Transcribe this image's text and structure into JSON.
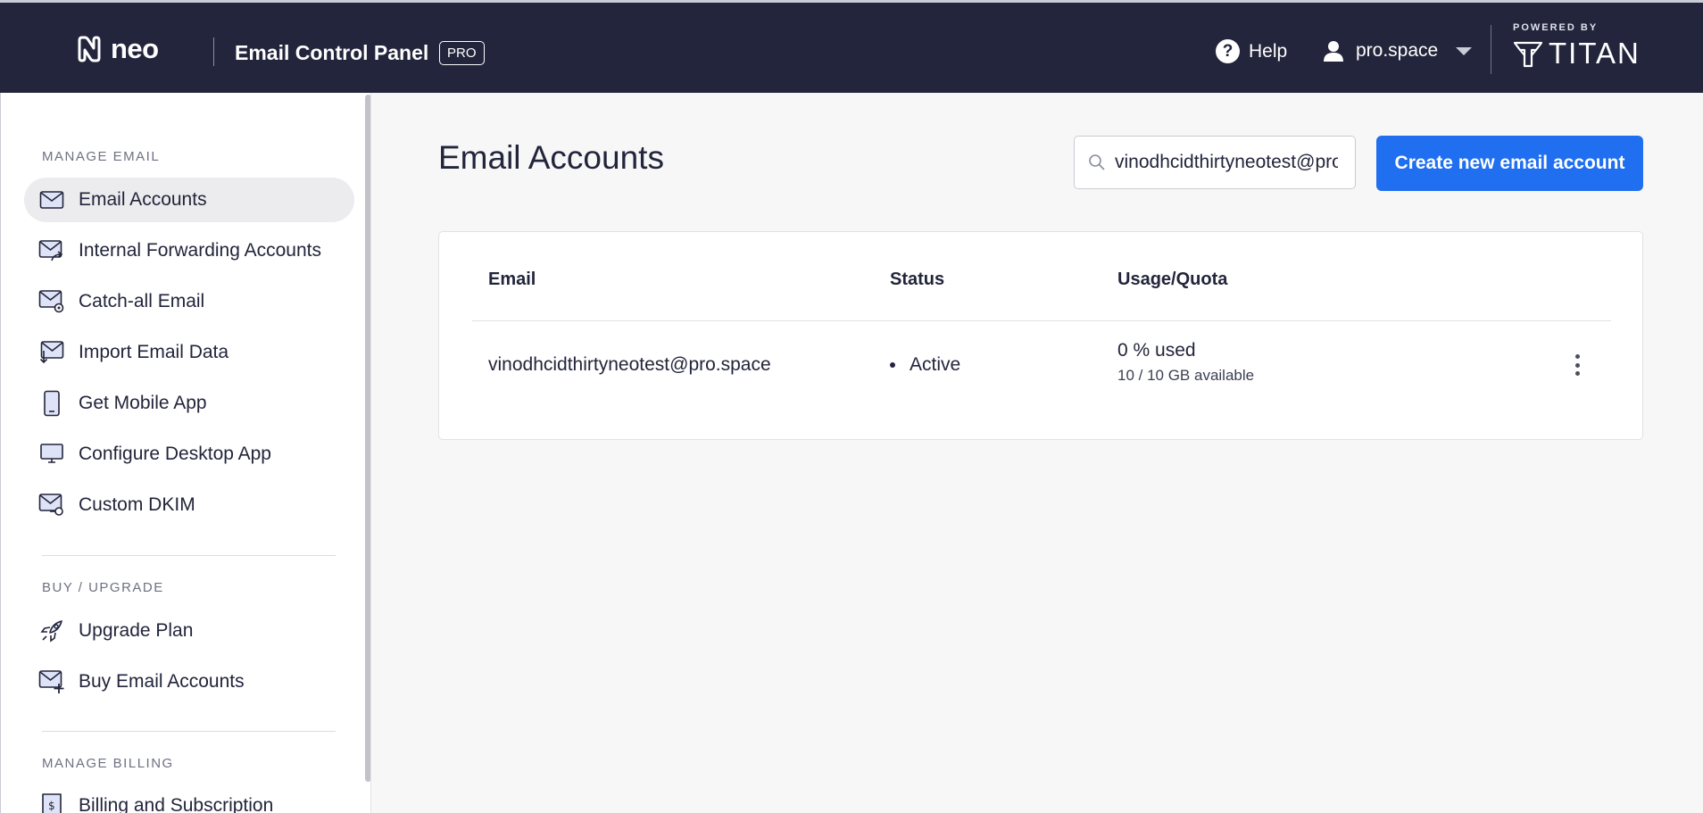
{
  "header": {
    "logo_text": "neo",
    "app_title": "Email Control Panel",
    "badge": "PRO",
    "help_label": "Help",
    "account_name": "pro.space",
    "powered_by": "POWERED BY",
    "partner_name": "TITAN"
  },
  "sidebar": {
    "sections": [
      {
        "label": "MANAGE EMAIL",
        "items": [
          {
            "label": "Email Accounts",
            "icon": "envelope-icon",
            "active": true
          },
          {
            "label": "Internal Forwarding Accounts",
            "icon": "forward-mail-icon"
          },
          {
            "label": "Catch-all Email",
            "icon": "mail-gear-icon"
          },
          {
            "label": "Import Email Data",
            "icon": "import-mail-icon"
          },
          {
            "label": "Get Mobile App",
            "icon": "mobile-icon"
          },
          {
            "label": "Configure Desktop App",
            "icon": "desktop-icon"
          },
          {
            "label": "Custom DKIM",
            "icon": "mail-key-icon"
          }
        ]
      },
      {
        "label": "BUY / UPGRADE",
        "items": [
          {
            "label": "Upgrade Plan",
            "icon": "rocket-icon"
          },
          {
            "label": "Buy Email Accounts",
            "icon": "mail-plus-icon"
          }
        ]
      },
      {
        "label": "MANAGE BILLING",
        "items": [
          {
            "label": "Billing and Subscription",
            "icon": "receipt-icon"
          }
        ]
      }
    ]
  },
  "main": {
    "title": "Email Accounts",
    "search_value": "vinodhcidthirtyneotest@pro.space",
    "create_button": "Create new email account",
    "table": {
      "columns": [
        "Email",
        "Status",
        "Usage/Quota"
      ],
      "rows": [
        {
          "email": "vinodhcidthirtyneotest@pro.space",
          "status": "Active",
          "usage": "0 % used",
          "quota": "10 / 10 GB available"
        }
      ]
    }
  },
  "colors": {
    "header_bg": "#22253b",
    "accent": "#1f6ff0",
    "active_nav": "#ececee"
  }
}
